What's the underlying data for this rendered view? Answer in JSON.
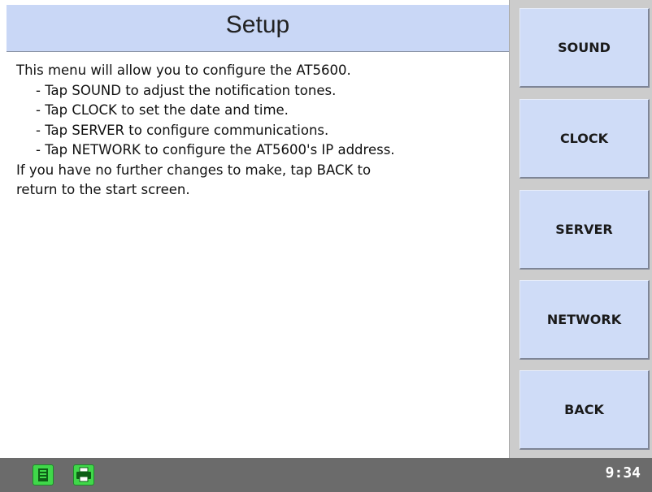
{
  "title": "Setup",
  "content": {
    "intro": "This menu will allow you to configure the AT5600.",
    "items": [
      "- Tap SOUND to adjust the notification tones.",
      "- Tap CLOCK to set the date and time.",
      "- Tap SERVER to configure communications.",
      "- Tap NETWORK to configure the AT5600's IP address."
    ],
    "outro_line1": "If you have no further changes to make, tap BACK to",
    "outro_line2": "return to the start screen."
  },
  "sidebar": {
    "buttons": [
      "SOUND",
      "CLOCK",
      "SERVER",
      "NETWORK",
      "BACK"
    ]
  },
  "status_bar": {
    "time": "9:34",
    "icons": [
      "list-icon",
      "printer-icon"
    ]
  },
  "colors": {
    "title_bg": "#c9d7f6",
    "button_bg": "#cfdcf7",
    "status_bg": "#6b6b6b",
    "icon_green": "#40d84a"
  }
}
